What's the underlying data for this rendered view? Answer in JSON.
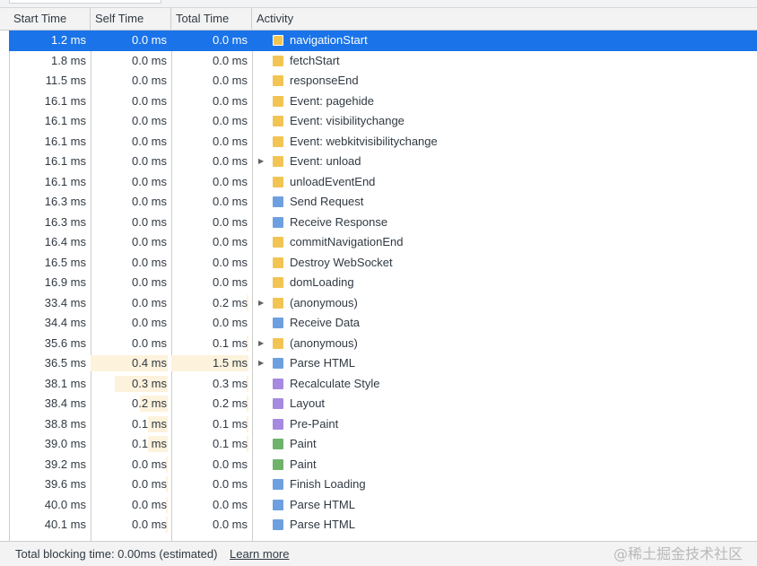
{
  "columns": {
    "start_time": "Start Time",
    "self_time": "Self Time",
    "total_time": "Total Time",
    "activity": "Activity"
  },
  "colors": {
    "loading": "#f2c453",
    "network": "#6ea0e0",
    "rendering": "#a68ae0",
    "painting": "#6fb36b",
    "selected": "#1a73e8"
  },
  "rows": [
    {
      "start": "1.2 ms",
      "self": "0.0 ms",
      "total": "0.0 ms",
      "activity": "navigationStart",
      "category": "loading",
      "expandable": false,
      "selected": true,
      "self_share": 0,
      "total_share": 0
    },
    {
      "start": "1.8 ms",
      "self": "0.0 ms",
      "total": "0.0 ms",
      "activity": "fetchStart",
      "category": "loading",
      "expandable": false,
      "selected": false,
      "self_share": 0,
      "total_share": 0
    },
    {
      "start": "11.5 ms",
      "self": "0.0 ms",
      "total": "0.0 ms",
      "activity": "responseEnd",
      "category": "loading",
      "expandable": false,
      "selected": false,
      "self_share": 0,
      "total_share": 0
    },
    {
      "start": "16.1 ms",
      "self": "0.0 ms",
      "total": "0.0 ms",
      "activity": "Event: pagehide",
      "category": "loading",
      "expandable": false,
      "selected": false,
      "self_share": 0,
      "total_share": 0
    },
    {
      "start": "16.1 ms",
      "self": "0.0 ms",
      "total": "0.0 ms",
      "activity": "Event: visibilitychange",
      "category": "loading",
      "expandable": false,
      "selected": false,
      "self_share": 0,
      "total_share": 0
    },
    {
      "start": "16.1 ms",
      "self": "0.0 ms",
      "total": "0.0 ms",
      "activity": "Event: webkitvisibilitychange",
      "category": "loading",
      "expandable": false,
      "selected": false,
      "self_share": 0,
      "total_share": 0
    },
    {
      "start": "16.1 ms",
      "self": "0.0 ms",
      "total": "0.0 ms",
      "activity": "Event: unload",
      "category": "loading",
      "expandable": true,
      "selected": false,
      "self_share": 0,
      "total_share": 0
    },
    {
      "start": "16.1 ms",
      "self": "0.0 ms",
      "total": "0.0 ms",
      "activity": "unloadEventEnd",
      "category": "loading",
      "expandable": false,
      "selected": false,
      "self_share": 0,
      "total_share": 0
    },
    {
      "start": "16.3 ms",
      "self": "0.0 ms",
      "total": "0.0 ms",
      "activity": "Send Request",
      "category": "network",
      "expandable": false,
      "selected": false,
      "self_share": 0,
      "total_share": 0
    },
    {
      "start": "16.3 ms",
      "self": "0.0 ms",
      "total": "0.0 ms",
      "activity": "Receive Response",
      "category": "network",
      "expandable": false,
      "selected": false,
      "self_share": 0,
      "total_share": 0
    },
    {
      "start": "16.4 ms",
      "self": "0.0 ms",
      "total": "0.0 ms",
      "activity": "commitNavigationEnd",
      "category": "loading",
      "expandable": false,
      "selected": false,
      "self_share": 0,
      "total_share": 0
    },
    {
      "start": "16.5 ms",
      "self": "0.0 ms",
      "total": "0.0 ms",
      "activity": "Destroy WebSocket",
      "category": "loading",
      "expandable": false,
      "selected": false,
      "self_share": 0,
      "total_share": 0
    },
    {
      "start": "16.9 ms",
      "self": "0.0 ms",
      "total": "0.0 ms",
      "activity": "domLoading",
      "category": "loading",
      "expandable": false,
      "selected": false,
      "self_share": 0,
      "total_share": 0
    },
    {
      "start": "33.4 ms",
      "self": "0.0 ms",
      "total": "0.2 ms",
      "activity": "(anonymous)",
      "category": "loading",
      "expandable": true,
      "selected": false,
      "self_share": 0,
      "total_share": 0.02
    },
    {
      "start": "34.4 ms",
      "self": "0.0 ms",
      "total": "0.0 ms",
      "activity": "Receive Data",
      "category": "network",
      "expandable": false,
      "selected": false,
      "self_share": 0,
      "total_share": 0
    },
    {
      "start": "35.6 ms",
      "self": "0.0 ms",
      "total": "0.1 ms",
      "activity": "(anonymous)",
      "category": "loading",
      "expandable": true,
      "selected": false,
      "self_share": 0,
      "total_share": 0.01
    },
    {
      "start": "36.5 ms",
      "self": "0.4 ms",
      "total": "1.5 ms",
      "activity": "Parse HTML",
      "category": "network",
      "expandable": true,
      "selected": false,
      "self_share": 1.0,
      "total_share": 1.0
    },
    {
      "start": "38.1 ms",
      "self": "0.3 ms",
      "total": "0.3 ms",
      "activity": "Recalculate Style",
      "category": "rendering",
      "expandable": false,
      "selected": false,
      "self_share": 0.69,
      "total_share": 0.02
    },
    {
      "start": "38.4 ms",
      "self": "0.2 ms",
      "total": "0.2 ms",
      "activity": "Layout",
      "category": "rendering",
      "expandable": false,
      "selected": false,
      "self_share": 0.36,
      "total_share": 0.02
    },
    {
      "start": "38.8 ms",
      "self": "0.1 ms",
      "total": "0.1 ms",
      "activity": "Pre-Paint",
      "category": "rendering",
      "expandable": false,
      "selected": false,
      "self_share": 0.26,
      "total_share": 0.01
    },
    {
      "start": "39.0 ms",
      "self": "0.1 ms",
      "total": "0.1 ms",
      "activity": "Paint",
      "category": "painting",
      "expandable": false,
      "selected": false,
      "self_share": 0.26,
      "total_share": 0.01
    },
    {
      "start": "39.2 ms",
      "self": "0.0 ms",
      "total": "0.0 ms",
      "activity": "Paint",
      "category": "painting",
      "expandable": false,
      "selected": false,
      "self_share": 0.02,
      "total_share": 0
    },
    {
      "start": "39.6 ms",
      "self": "0.0 ms",
      "total": "0.0 ms",
      "activity": "Finish Loading",
      "category": "network",
      "expandable": false,
      "selected": false,
      "self_share": 0.02,
      "total_share": 0
    },
    {
      "start": "40.0 ms",
      "self": "0.0 ms",
      "total": "0.0 ms",
      "activity": "Parse HTML",
      "category": "network",
      "expandable": false,
      "selected": false,
      "self_share": 0.02,
      "total_share": 0
    },
    {
      "start": "40.1 ms",
      "self": "0.0 ms",
      "total": "0.0 ms",
      "activity": "Parse HTML",
      "category": "network",
      "expandable": false,
      "selected": false,
      "self_share": 0.02,
      "total_share": 0
    }
  ],
  "footer": {
    "blocking_time": "Total blocking time: 0.00ms (estimated)",
    "learn_more": "Learn more",
    "watermark": "@稀土掘金技术社区"
  }
}
